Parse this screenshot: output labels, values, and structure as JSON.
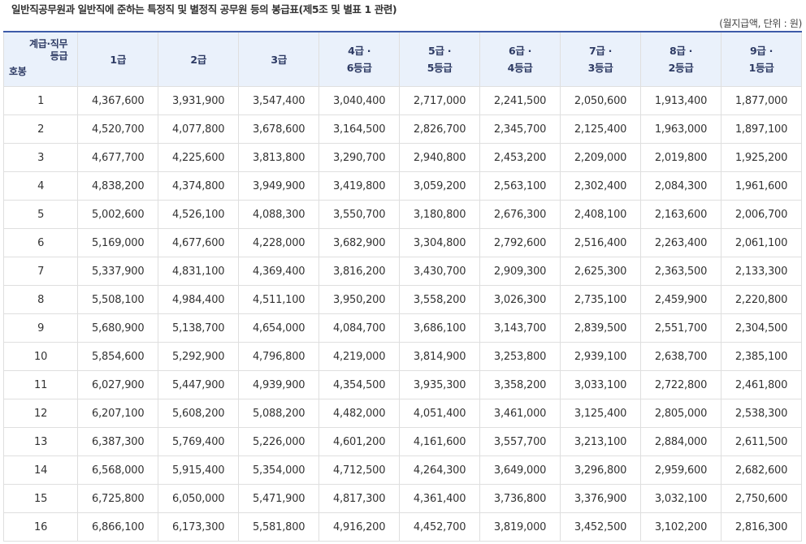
{
  "title": "일반직공무원과 일반직에 준하는 특정직 및 별정직 공무원 등의 봉급표(제5조 및 별표 1 관련)",
  "unit_note": "(월지급액, 단위 : 원)",
  "corner": {
    "top_line1": "계급·직무",
    "top_line2": "등급",
    "bottom": "호봉"
  },
  "columns": [
    {
      "line1": "1급",
      "line2": ""
    },
    {
      "line1": "2급",
      "line2": ""
    },
    {
      "line1": "3급",
      "line2": ""
    },
    {
      "line1": "4급 ·",
      "line2": "6등급"
    },
    {
      "line1": "5급 ·",
      "line2": "5등급"
    },
    {
      "line1": "6급 ·",
      "line2": "4등급"
    },
    {
      "line1": "7급 ·",
      "line2": "3등급"
    },
    {
      "line1": "8급 ·",
      "line2": "2등급"
    },
    {
      "line1": "9급 ·",
      "line2": "1등급"
    }
  ],
  "rows": [
    {
      "step": "1",
      "values": [
        "4,367,600",
        "3,931,900",
        "3,547,400",
        "3,040,400",
        "2,717,000",
        "2,241,500",
        "2,050,600",
        "1,913,400",
        "1,877,000"
      ]
    },
    {
      "step": "2",
      "values": [
        "4,520,700",
        "4,077,800",
        "3,678,600",
        "3,164,500",
        "2,826,700",
        "2,345,700",
        "2,125,400",
        "1,963,000",
        "1,897,100"
      ]
    },
    {
      "step": "3",
      "values": [
        "4,677,700",
        "4,225,600",
        "3,813,800",
        "3,290,700",
        "2,940,800",
        "2,453,200",
        "2,209,000",
        "2,019,800",
        "1,925,200"
      ]
    },
    {
      "step": "4",
      "values": [
        "4,838,200",
        "4,374,800",
        "3,949,900",
        "3,419,800",
        "3,059,200",
        "2,563,100",
        "2,302,400",
        "2,084,300",
        "1,961,600"
      ]
    },
    {
      "step": "5",
      "values": [
        "5,002,600",
        "4,526,100",
        "4,088,300",
        "3,550,700",
        "3,180,800",
        "2,676,300",
        "2,408,100",
        "2,163,600",
        "2,006,700"
      ]
    },
    {
      "step": "6",
      "values": [
        "5,169,000",
        "4,677,600",
        "4,228,000",
        "3,682,900",
        "3,304,800",
        "2,792,600",
        "2,516,400",
        "2,263,400",
        "2,061,100"
      ]
    },
    {
      "step": "7",
      "values": [
        "5,337,900",
        "4,831,100",
        "4,369,400",
        "3,816,200",
        "3,430,700",
        "2,909,300",
        "2,625,300",
        "2,363,500",
        "2,133,300"
      ]
    },
    {
      "step": "8",
      "values": [
        "5,508,100",
        "4,984,400",
        "4,511,100",
        "3,950,200",
        "3,558,200",
        "3,026,300",
        "2,735,100",
        "2,459,900",
        "2,220,800"
      ]
    },
    {
      "step": "9",
      "values": [
        "5,680,900",
        "5,138,700",
        "4,654,000",
        "4,084,700",
        "3,686,100",
        "3,143,700",
        "2,839,500",
        "2,551,700",
        "2,304,500"
      ]
    },
    {
      "step": "10",
      "values": [
        "5,854,600",
        "5,292,900",
        "4,796,800",
        "4,219,000",
        "3,814,900",
        "3,253,800",
        "2,939,100",
        "2,638,700",
        "2,385,100"
      ]
    },
    {
      "step": "11",
      "values": [
        "6,027,900",
        "5,447,900",
        "4,939,900",
        "4,354,500",
        "3,935,300",
        "3,358,200",
        "3,033,100",
        "2,722,800",
        "2,461,800"
      ]
    },
    {
      "step": "12",
      "values": [
        "6,207,100",
        "5,608,200",
        "5,088,200",
        "4,482,000",
        "4,051,400",
        "3,461,000",
        "3,125,400",
        "2,805,000",
        "2,538,300"
      ]
    },
    {
      "step": "13",
      "values": [
        "6,387,300",
        "5,769,400",
        "5,226,000",
        "4,601,200",
        "4,161,600",
        "3,557,700",
        "3,213,100",
        "2,884,000",
        "2,611,500"
      ]
    },
    {
      "step": "14",
      "values": [
        "6,568,000",
        "5,915,400",
        "5,354,000",
        "4,712,500",
        "4,264,300",
        "3,649,000",
        "3,296,800",
        "2,959,600",
        "2,682,600"
      ]
    },
    {
      "step": "15",
      "values": [
        "6,725,800",
        "6,050,000",
        "5,471,900",
        "4,817,300",
        "4,361,400",
        "3,736,800",
        "3,376,900",
        "3,032,100",
        "2,750,600"
      ]
    },
    {
      "step": "16",
      "values": [
        "6,866,100",
        "6,173,300",
        "5,581,800",
        "4,916,200",
        "4,452,700",
        "3,819,000",
        "3,452,500",
        "3,102,200",
        "2,816,300"
      ]
    }
  ],
  "colors": {
    "header_bg": "#eaf1fb",
    "header_text": "#2e3b64",
    "top_border": "#3d5ba9",
    "grid": "#dfdfdf"
  }
}
